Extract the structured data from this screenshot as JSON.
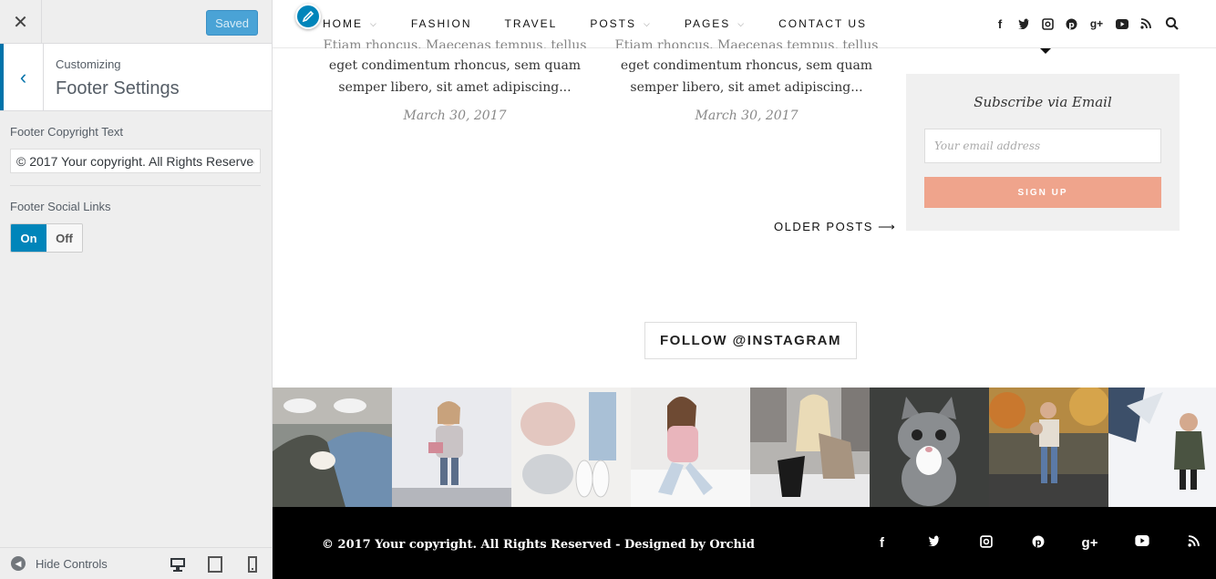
{
  "customizer": {
    "close_icon": "close-icon",
    "saved_label": "Saved",
    "breadcrumb": "Customizing",
    "section_title": "Footer Settings",
    "copyright_label": "Footer Copyright Text",
    "copyright_value": "© 2017 Your copyright. All Rights Reserved",
    "social_label": "Footer Social Links",
    "toggle_on": "On",
    "toggle_off": "Off",
    "toggle_state": "on",
    "hide_controls": "Hide Controls",
    "accent": "#0085ba"
  },
  "nav": {
    "items": [
      {
        "label": "HOME",
        "dropdown": true
      },
      {
        "label": "FASHION",
        "dropdown": false
      },
      {
        "label": "TRAVEL",
        "dropdown": false
      },
      {
        "label": "POSTS",
        "dropdown": true
      },
      {
        "label": "PAGES",
        "dropdown": true
      },
      {
        "label": "CONTACT US",
        "dropdown": false
      }
    ],
    "social_icons": [
      "facebook-icon",
      "twitter-icon",
      "instagram-icon",
      "pinterest-icon",
      "google-plus-icon",
      "youtube-icon",
      "rss-icon"
    ]
  },
  "posts": [
    {
      "cut_line": "Etiam rhoncus. Maecenas tempus, tellus",
      "excerpt": "eget condimentum rhoncus, sem quam semper libero, sit amet adipiscing...",
      "date": "March 30, 2017"
    },
    {
      "cut_line": "Etiam rhoncus. Maecenas tempus, tellus",
      "excerpt": "eget condimentum rhoncus, sem quam semper libero, sit amet adipiscing...",
      "date": "March 30, 2017"
    }
  ],
  "older_posts": "OLDER POSTS ⟶",
  "subscribe": {
    "title": "Subscribe via Email",
    "placeholder": "Your email address",
    "button": "SIGN UP",
    "button_color": "#efa48c"
  },
  "instagram": {
    "button": "FOLLOW @INSTAGRAM",
    "photos": [
      "sneakers-photo",
      "toddler-photo",
      "flatlay-photo",
      "selfie-photo",
      "blonde-photo",
      "kitten-photo",
      "autumn-photo",
      "snow-photo"
    ]
  },
  "footer": {
    "copyright": "© 2017 Your copyright. All Rights Reserved - Designed by Orchid",
    "social_icons": [
      "facebook-icon",
      "twitter-icon",
      "instagram-icon",
      "pinterest-icon",
      "google-plus-icon",
      "youtube-icon",
      "rss-icon"
    ]
  }
}
